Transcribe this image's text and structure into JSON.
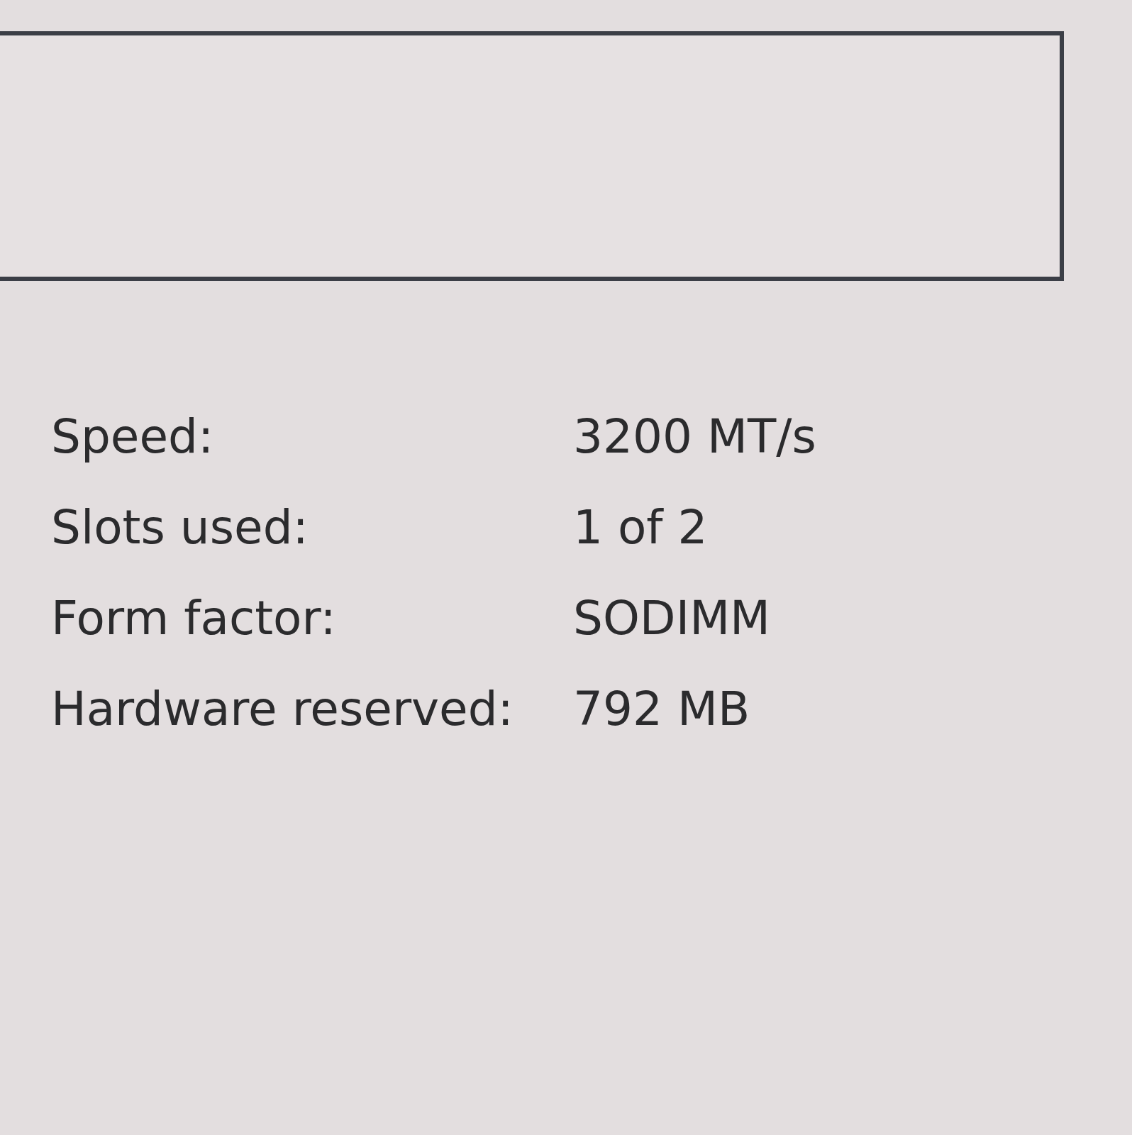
{
  "details": [
    {
      "label": "Speed:",
      "value": "3200 MT/s"
    },
    {
      "label": "Slots used:",
      "value": "1 of 2"
    },
    {
      "label": "Form factor:",
      "value": "SODIMM"
    },
    {
      "label": "Hardware reserved:",
      "value": "792 MB"
    }
  ]
}
